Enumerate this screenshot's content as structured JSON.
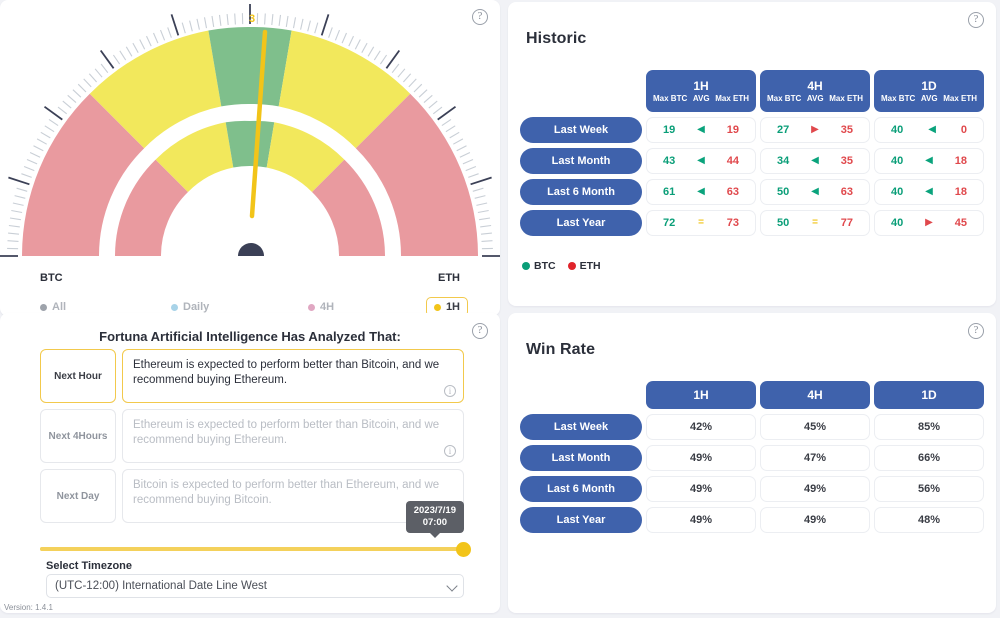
{
  "gauge": {
    "value_label": "3",
    "left_label": "BTC",
    "right_label": "ETH",
    "help_icon": "help-circle-icon",
    "colors": {
      "red": "#e99a9f",
      "yellow": "#f2e85c",
      "green": "#7fbf8c",
      "needle": "#f2c419",
      "pivot": "#3b4056"
    },
    "legend": [
      {
        "label": "All",
        "color": "#9ea3ab",
        "active": false
      },
      {
        "label": "Daily",
        "color": "#a8d3e8",
        "active": false
      },
      {
        "label": "4H",
        "color": "#e0a7c2",
        "active": false
      },
      {
        "label": "1H",
        "color": "#f2c419",
        "active": true
      }
    ]
  },
  "ai": {
    "title": "Fortuna Artificial Intelligence Has Analyzed That:",
    "help_icon": "help-circle-icon",
    "predictions": [
      {
        "tag": "Next Hour",
        "text": "Ethereum is expected to perform better than Bitcoin, and we recommend buying Ethereum.",
        "active": true
      },
      {
        "tag": "Next 4Hours",
        "text": "Ethereum is expected to perform better than Bitcoin, and we recommend buying Ethereum.",
        "active": false
      },
      {
        "tag": "Next Day",
        "text": "Bitcoin is expected to perform better than Ethereum, and we recommend buying Bitcoin.",
        "active": false
      }
    ],
    "slider": {
      "tooltip_date": "2023/7/19",
      "tooltip_time": "07:00",
      "fill_color": "#f2c419"
    },
    "timezone_label": "Select Timezone",
    "timezone_value": "(UTC-12:00) International Date Line West",
    "timezone_options": [
      "(UTC-12:00) International Date Line West"
    ],
    "version": "Version: 1.4.1"
  },
  "historic": {
    "title": "Historic",
    "help_icon": "help-circle-icon",
    "columns": [
      {
        "main": "1H",
        "subs": [
          "Max BTC",
          "AVG",
          "Max ETH"
        ]
      },
      {
        "main": "4H",
        "subs": [
          "Max BTC",
          "AVG",
          "Max ETH"
        ]
      },
      {
        "main": "1D",
        "subs": [
          "Max BTC",
          "AVG",
          "Max ETH"
        ]
      }
    ],
    "rows": [
      {
        "label": "Last Week",
        "cells": [
          {
            "btc": "19",
            "arrow": "left",
            "eth": "19"
          },
          {
            "btc": "27",
            "arrow": "right",
            "eth": "35"
          },
          {
            "btc": "40",
            "arrow": "left",
            "eth": "0"
          }
        ]
      },
      {
        "label": "Last Month",
        "cells": [
          {
            "btc": "43",
            "arrow": "left",
            "eth": "44"
          },
          {
            "btc": "34",
            "arrow": "left",
            "eth": "35"
          },
          {
            "btc": "40",
            "arrow": "left",
            "eth": "18"
          }
        ]
      },
      {
        "label": "Last 6 Month",
        "cells": [
          {
            "btc": "61",
            "arrow": "left",
            "eth": "63"
          },
          {
            "btc": "50",
            "arrow": "left",
            "eth": "63"
          },
          {
            "btc": "40",
            "arrow": "left",
            "eth": "18"
          }
        ]
      },
      {
        "label": "Last Year",
        "cells": [
          {
            "btc": "72",
            "arrow": "eq",
            "eth": "73"
          },
          {
            "btc": "50",
            "arrow": "eq",
            "eth": "77"
          },
          {
            "btc": "40",
            "arrow": "right",
            "eth": "45"
          }
        ]
      }
    ],
    "legend": [
      {
        "label": "BTC",
        "color": "#0a9e78"
      },
      {
        "label": "ETH",
        "color": "#e0242b"
      }
    ]
  },
  "winrate": {
    "title": "Win Rate",
    "help_icon": "help-circle-icon",
    "columns": [
      "1H",
      "4H",
      "1D"
    ],
    "rows": [
      {
        "label": "Last Week",
        "values": [
          "42%",
          "45%",
          "85%"
        ]
      },
      {
        "label": "Last Month",
        "values": [
          "49%",
          "47%",
          "66%"
        ]
      },
      {
        "label": "Last 6 Month",
        "values": [
          "49%",
          "49%",
          "56%"
        ]
      },
      {
        "label": "Last Year",
        "values": [
          "49%",
          "49%",
          "48%"
        ]
      }
    ]
  },
  "arrow_glyphs": {
    "left": "◀",
    "right": "▶",
    "eq": "="
  }
}
